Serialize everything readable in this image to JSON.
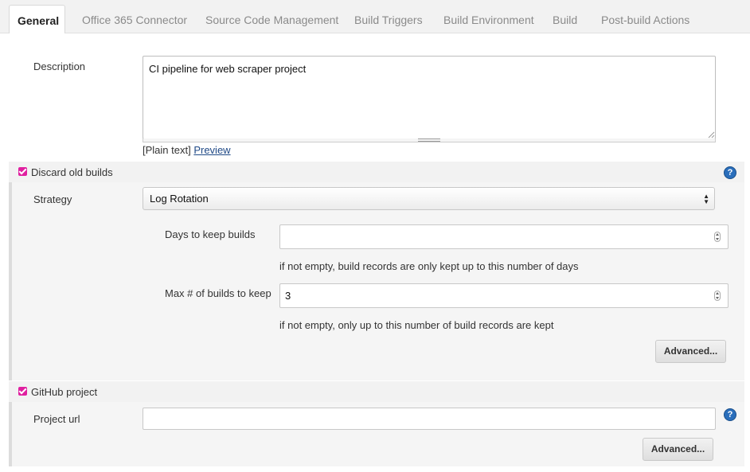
{
  "tabs": [
    {
      "label": "General"
    },
    {
      "label": "Office 365 Connector"
    },
    {
      "label": "Source Code Management"
    },
    {
      "label": "Build Triggers"
    },
    {
      "label": "Build Environment"
    },
    {
      "label": "Build"
    },
    {
      "label": "Post-build Actions"
    }
  ],
  "description": {
    "label": "Description",
    "value": "CI pipeline for web scraper project",
    "format_prefix": "[Plain text]",
    "preview_link": "Preview"
  },
  "discard_old_builds": {
    "label": "Discard old builds",
    "checked": true,
    "strategy_label": "Strategy",
    "strategy_value": "Log Rotation",
    "days_label": "Days to keep builds",
    "days_value": "",
    "days_hint": "if not empty, build records are only kept up to this number of days",
    "max_label": "Max # of builds to keep",
    "max_value": "3",
    "max_hint": "if not empty, only up to this number of build records are kept",
    "advanced_label": "Advanced..."
  },
  "github_project": {
    "label": "GitHub project",
    "checked": true,
    "url_label": "Project url",
    "url_value": "",
    "advanced_label": "Advanced..."
  },
  "colors": {
    "checkbox": "#e020a0",
    "link": "#204a87",
    "help_icon": "#2a6ebb"
  },
  "icons": {
    "help": "help-icon",
    "select_arrows": "select-arrows-icon",
    "spinner": "spinner-icon"
  }
}
